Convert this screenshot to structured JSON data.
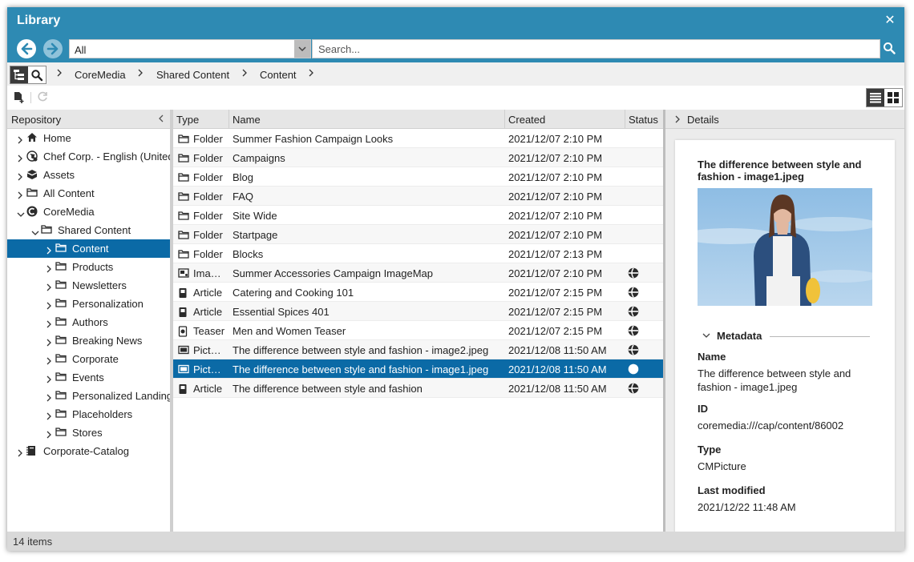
{
  "window": {
    "title": "Library",
    "close_icon": "close-icon"
  },
  "search": {
    "filter_value": "All",
    "placeholder": "Search..."
  },
  "breadcrumb": [
    "CoreMedia",
    "Shared Content",
    "Content"
  ],
  "tree": {
    "header": "Repository",
    "items": [
      {
        "label": "Home",
        "icon": "home-icon",
        "level": 0,
        "expanded": false
      },
      {
        "label": "Chef Corp. - English (United",
        "icon": "site-icon",
        "level": 0,
        "expanded": false
      },
      {
        "label": "Assets",
        "icon": "assets-icon",
        "level": 0,
        "expanded": false
      },
      {
        "label": "All Content",
        "icon": "folder-icon",
        "level": 0,
        "expanded": false
      },
      {
        "label": "CoreMedia",
        "icon": "coremedia-icon",
        "level": 0,
        "expanded": true
      },
      {
        "label": "Shared Content",
        "icon": "folder-icon",
        "level": 1,
        "expanded": true
      },
      {
        "label": "Content",
        "icon": "folder-icon",
        "level": 2,
        "expanded": false,
        "selected": true
      },
      {
        "label": "Products",
        "icon": "folder-icon",
        "level": 2,
        "expanded": false
      },
      {
        "label": "Newsletters",
        "icon": "folder-icon",
        "level": 2,
        "expanded": false
      },
      {
        "label": "Personalization",
        "icon": "folder-icon",
        "level": 2,
        "expanded": false
      },
      {
        "label": "Authors",
        "icon": "folder-icon",
        "level": 2,
        "expanded": false
      },
      {
        "label": "Breaking News",
        "icon": "folder-icon",
        "level": 2,
        "expanded": false
      },
      {
        "label": "Corporate",
        "icon": "folder-icon",
        "level": 2,
        "expanded": false
      },
      {
        "label": "Events",
        "icon": "folder-icon",
        "level": 2,
        "expanded": false
      },
      {
        "label": "Personalized Landing",
        "icon": "folder-icon",
        "level": 2,
        "expanded": false
      },
      {
        "label": "Placeholders",
        "icon": "folder-icon",
        "level": 2,
        "expanded": false
      },
      {
        "label": "Stores",
        "icon": "folder-icon",
        "level": 2,
        "expanded": false
      },
      {
        "label": "Corporate-Catalog",
        "icon": "catalog-icon",
        "level": 0,
        "expanded": false
      }
    ]
  },
  "grid": {
    "columns": [
      "Type",
      "Name",
      "Created",
      "Status"
    ],
    "rows": [
      {
        "type": "Folder",
        "icon": "folder-icon",
        "name": "Summer Fashion Campaign Looks",
        "created": "2021/12/07 2:10 PM",
        "status": ""
      },
      {
        "type": "Folder",
        "icon": "folder-icon",
        "name": "Campaigns",
        "created": "2021/12/07 2:10 PM",
        "status": ""
      },
      {
        "type": "Folder",
        "icon": "folder-icon",
        "name": "Blog",
        "created": "2021/12/07 2:10 PM",
        "status": ""
      },
      {
        "type": "Folder",
        "icon": "folder-icon",
        "name": "FAQ",
        "created": "2021/12/07 2:10 PM",
        "status": ""
      },
      {
        "type": "Folder",
        "icon": "folder-icon",
        "name": "Site Wide",
        "created": "2021/12/07 2:10 PM",
        "status": ""
      },
      {
        "type": "Folder",
        "icon": "folder-icon",
        "name": "Startpage",
        "created": "2021/12/07 2:10 PM",
        "status": ""
      },
      {
        "type": "Folder",
        "icon": "folder-icon",
        "name": "Blocks",
        "created": "2021/12/07 2:13 PM",
        "status": ""
      },
      {
        "type": "Imag…",
        "icon": "imagemap-icon",
        "name": "Summer Accessories Campaign ImageMap",
        "created": "2021/12/07 2:10 PM",
        "status": "published-icon"
      },
      {
        "type": "Article",
        "icon": "article-icon",
        "name": "Catering and Cooking 101",
        "created": "2021/12/07 2:15 PM",
        "status": "published-icon"
      },
      {
        "type": "Article",
        "icon": "article-icon",
        "name": "Essential Spices 401",
        "created": "2021/12/07 2:15 PM",
        "status": "published-icon"
      },
      {
        "type": "Teaser",
        "icon": "teaser-icon",
        "name": "Men and Women Teaser",
        "created": "2021/12/07 2:15 PM",
        "status": "published-icon"
      },
      {
        "type": "Pictu…",
        "icon": "picture-icon",
        "name": "The difference between style and fashion - image2.jpeg",
        "created": "2021/12/08 11:50 AM",
        "status": "published-icon"
      },
      {
        "type": "Pictu…",
        "icon": "picture-icon",
        "name": "The difference between style and fashion - image1.jpeg",
        "created": "2021/12/08 11:50 AM",
        "status": "published-icon",
        "selected": true
      },
      {
        "type": "Article",
        "icon": "article-icon",
        "name": "The difference between style and fashion",
        "created": "2021/12/08 11:50 AM",
        "status": "published-icon"
      }
    ]
  },
  "details": {
    "header": "Details",
    "title": "The difference between style and fashion - image1.jpeg",
    "metadata_label": "Metadata",
    "fields": [
      {
        "label": "Name",
        "value": "The difference between style and fashion - image1.jpeg"
      },
      {
        "label": "ID",
        "value": "coremedia:///cap/content/86002"
      },
      {
        "label": "Type",
        "value": "CMPicture"
      },
      {
        "label": "Last modified",
        "value": "2021/12/22 11:48 AM"
      }
    ]
  },
  "statusbar": {
    "count": "14 items"
  },
  "colors": {
    "titlebar": "#2e8ab3",
    "selection": "#0b6aa6"
  }
}
